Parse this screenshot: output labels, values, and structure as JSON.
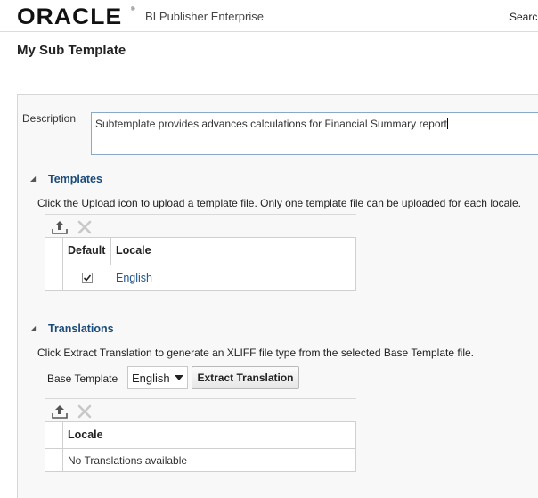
{
  "header": {
    "logo_text": "ORACLE",
    "logo_mark": "®",
    "product_name": "BI Publisher Enterprise",
    "search_label": "Search"
  },
  "page": {
    "title": "My Sub Template"
  },
  "description": {
    "label": "Description",
    "value": "Subtemplate provides advances calculations for Financial Summary report"
  },
  "templates": {
    "toggle": "◢",
    "title": "Templates",
    "help": "Click the Upload icon to upload a template file. Only one template file can be uploaded for each locale.",
    "columns": {
      "default": "Default",
      "locale": "Locale"
    },
    "rows": [
      {
        "default_checked": true,
        "locale": "English"
      }
    ],
    "icons": {
      "upload": "upload-icon",
      "delete": "delete-icon"
    }
  },
  "translations": {
    "toggle": "◢",
    "title": "Translations",
    "help": "Click Extract Translation to generate an XLIFF file type from the selected Base Template file.",
    "base_template_label": "Base Template",
    "base_template_value": "English",
    "extract_button": "Extract Translation",
    "columns": {
      "locale": "Locale"
    },
    "empty_text": "No Translations available",
    "icons": {
      "upload": "upload-icon",
      "delete": "delete-icon"
    }
  },
  "colors": {
    "section_title": "#1a4b7a",
    "link": "#21558f",
    "panel_bg": "#f8f8f8"
  }
}
